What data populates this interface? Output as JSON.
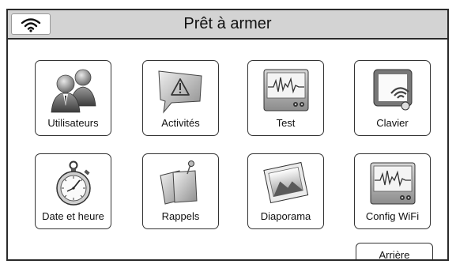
{
  "header": {
    "title": "Prêt à armer",
    "wifi_icon": "wifi-icon"
  },
  "tiles": [
    {
      "label": "Utilisateurs",
      "icon": "users-icon"
    },
    {
      "label": "Activités",
      "icon": "alert-speech-bubble-icon"
    },
    {
      "label": "Test",
      "icon": "heartbeat-monitor-icon"
    },
    {
      "label": "Clavier",
      "icon": "tablet-wifi-icon"
    },
    {
      "label": "Date et heure",
      "icon": "stopwatch-icon"
    },
    {
      "label": "Rappels",
      "icon": "pinned-notes-icon"
    },
    {
      "label": "Diaporama",
      "icon": "photo-icon"
    },
    {
      "label": "Config WiFi",
      "icon": "heartbeat-monitor-icon"
    }
  ],
  "footer": {
    "back_label": "Arrière"
  }
}
